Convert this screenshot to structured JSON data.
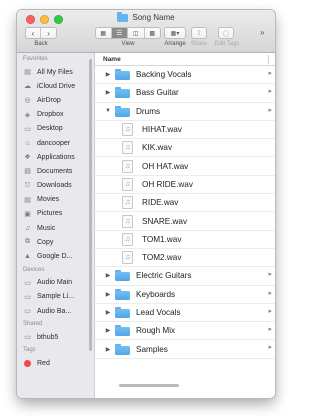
{
  "window": {
    "title": "Song Name",
    "lights": {
      "close": "#fc605c",
      "minimize": "#fdbc40",
      "zoom": "#34c84a"
    }
  },
  "toolbar": {
    "back_label": "Back",
    "view_label": "View",
    "arrange_label": "Arrange",
    "share_label": "Share",
    "edit_tags_label": "Edit Tags",
    "overflow": "»"
  },
  "sidebar": {
    "favorites_header": "Favorites",
    "favorites": [
      {
        "label": "All My Files",
        "icon": "all-files-icon"
      },
      {
        "label": "iCloud Drive",
        "icon": "cloud-icon"
      },
      {
        "label": "AirDrop",
        "icon": "airdrop-icon"
      },
      {
        "label": "Dropbox",
        "icon": "dropbox-icon"
      },
      {
        "label": "Desktop",
        "icon": "desktop-icon"
      },
      {
        "label": "dancooper",
        "icon": "home-icon"
      },
      {
        "label": "Applications",
        "icon": "applications-icon"
      },
      {
        "label": "Documents",
        "icon": "documents-icon"
      },
      {
        "label": "Downloads",
        "icon": "downloads-icon"
      },
      {
        "label": "Movies",
        "icon": "movies-icon"
      },
      {
        "label": "Pictures",
        "icon": "pictures-icon"
      },
      {
        "label": "Music",
        "icon": "music-icon"
      },
      {
        "label": "Copy",
        "icon": "copy-icon"
      },
      {
        "label": "Google D...",
        "icon": "google-drive-icon"
      }
    ],
    "devices_header": "Devices",
    "devices": [
      {
        "label": "Audio Main",
        "icon": "disk-icon"
      },
      {
        "label": "Sample Li...",
        "icon": "disk-icon"
      },
      {
        "label": "Audio Ba...",
        "icon": "disk-icon"
      }
    ],
    "shared_header": "Shared",
    "shared": [
      {
        "label": "bthub5",
        "icon": "server-icon"
      }
    ],
    "tags_header": "Tags",
    "tags": [
      {
        "label": "Red",
        "color": "#f0494b"
      }
    ]
  },
  "list": {
    "column_name": "Name",
    "rows": [
      {
        "name": "Backing Vocals",
        "kind": "folder",
        "expanded": false
      },
      {
        "name": "Bass Guitar",
        "kind": "folder",
        "expanded": false
      },
      {
        "name": "Drums",
        "kind": "folder",
        "expanded": true
      },
      {
        "name": "HIHAT.wav",
        "kind": "file"
      },
      {
        "name": "KIK.wav",
        "kind": "file"
      },
      {
        "name": "OH HAT.wav",
        "kind": "file"
      },
      {
        "name": "OH RIDE.wav",
        "kind": "file"
      },
      {
        "name": "RIDE.wav",
        "kind": "file"
      },
      {
        "name": "SNARE.wav",
        "kind": "file"
      },
      {
        "name": "TOM1.wav",
        "kind": "file"
      },
      {
        "name": "TOM2.wav",
        "kind": "file"
      },
      {
        "name": "Electric Guitars",
        "kind": "folder",
        "expanded": false
      },
      {
        "name": "Keyboards",
        "kind": "folder",
        "expanded": false
      },
      {
        "name": "Lead Vocals",
        "kind": "folder",
        "expanded": false
      },
      {
        "name": "Rough Mix",
        "kind": "folder",
        "expanded": false
      },
      {
        "name": "Samples",
        "kind": "folder",
        "expanded": false
      }
    ]
  }
}
